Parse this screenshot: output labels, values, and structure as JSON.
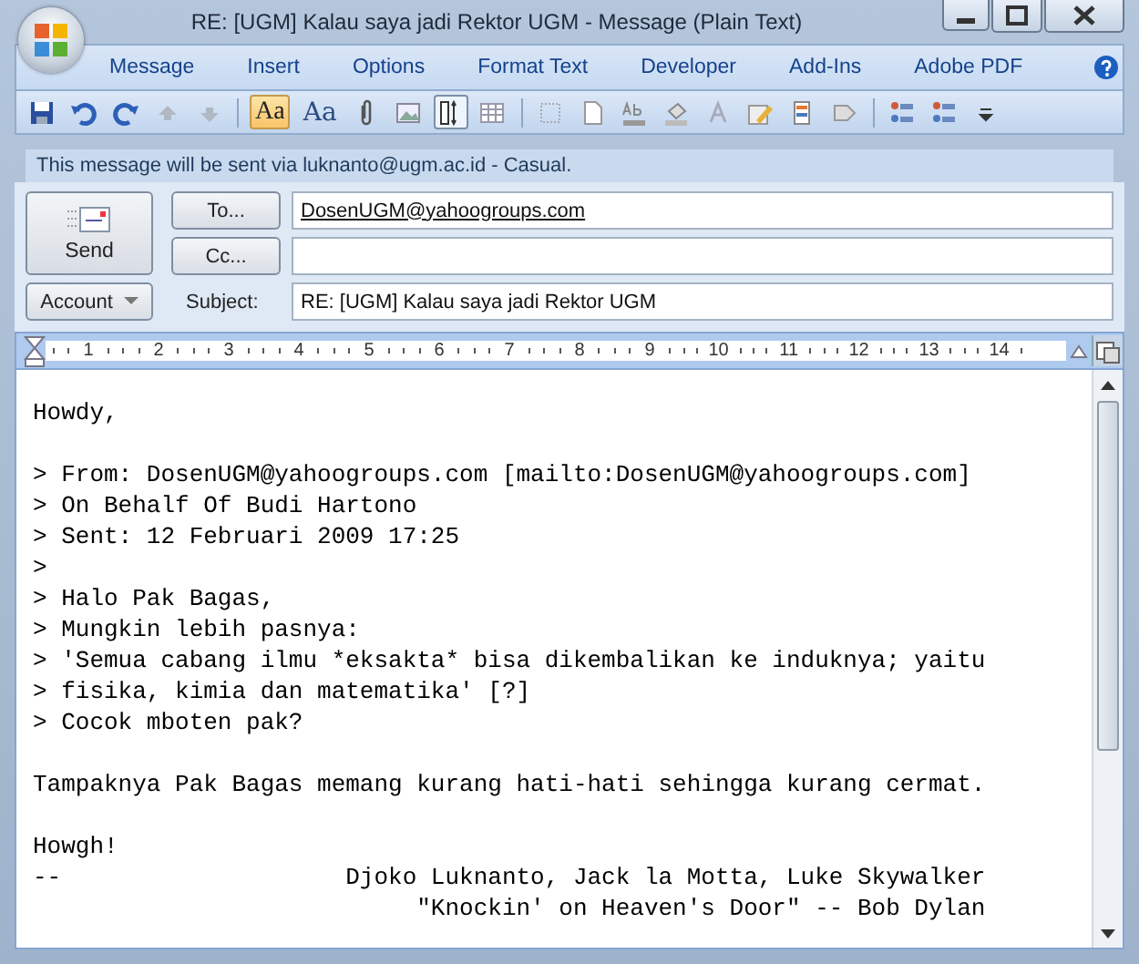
{
  "window": {
    "title": "RE: [UGM] Kalau saya jadi Rektor UGM - Message (Plain Text)"
  },
  "ribbon_tabs": [
    {
      "label": "Message"
    },
    {
      "label": "Insert"
    },
    {
      "label": "Options"
    },
    {
      "label": "Format Text"
    },
    {
      "label": "Developer"
    },
    {
      "label": "Add-Ins"
    },
    {
      "label": "Adobe PDF"
    }
  ],
  "toolbar": [
    {
      "kind": "save",
      "selected": false
    },
    {
      "kind": "undo",
      "selected": false
    },
    {
      "kind": "redo",
      "selected": false
    },
    {
      "kind": "up",
      "selected": false
    },
    {
      "kind": "down",
      "selected": false
    },
    {
      "kind": "sep"
    },
    {
      "kind": "text",
      "label": "Aa",
      "selected": true
    },
    {
      "kind": "text",
      "label": "Aa",
      "selected": false
    },
    {
      "kind": "clip",
      "selected": false
    },
    {
      "kind": "image",
      "selected": false
    },
    {
      "kind": "ruler",
      "selected": true
    },
    {
      "kind": "table",
      "selected": false
    },
    {
      "kind": "sep"
    },
    {
      "kind": "border",
      "selected": false
    },
    {
      "kind": "page",
      "selected": false
    },
    {
      "kind": "spell",
      "selected": false
    },
    {
      "kind": "fill",
      "selected": false
    },
    {
      "kind": "font",
      "selected": false
    },
    {
      "kind": "highlight",
      "selected": false
    },
    {
      "kind": "form",
      "selected": false
    },
    {
      "kind": "stamp",
      "selected": false
    },
    {
      "kind": "sep"
    },
    {
      "kind": "list",
      "selected": false
    },
    {
      "kind": "list",
      "selected": false
    },
    {
      "kind": "more",
      "selected": false
    }
  ],
  "info_bar": "This message will be sent via luknanto@ugm.ac.id - Casual.",
  "send_button": "Send",
  "to": {
    "button": "To...",
    "value": "DosenUGM@yahoogroups.com"
  },
  "cc": {
    "button": "Cc..."
  },
  "account_button": "Account",
  "subject": {
    "label": "Subject:",
    "value": "RE: [UGM] Kalau saya jadi Rektor UGM"
  },
  "ruler": [
    "1",
    "2",
    "3",
    "4",
    "5",
    "6",
    "7",
    "8",
    "9",
    "10",
    "11",
    "12",
    "13",
    "14"
  ],
  "body_paragraphs": [
    [
      "Howdy,"
    ],
    [
      "> From: DosenUGM@yahoogroups.com [mailto:DosenUGM@yahoogroups.com]",
      "> On Behalf Of Budi Hartono",
      "> Sent: 12 Februari 2009 17:25",
      ">",
      "> Halo Pak Bagas,",
      "> Mungkin lebih pasnya:",
      "> 'Semua cabang ilmu *eksakta* bisa dikembalikan ke induknya; yaitu",
      "> fisika, kimia dan matematika' [?]",
      "> Cocok mboten pak?"
    ],
    [
      "Tampaknya Pak Bagas memang kurang hati-hati sehingga kurang cermat."
    ],
    [
      "Howgh!",
      "--                    Djoko Luknanto, Jack la Motta, Luke Skywalker",
      "                           \"Knockin' on Heaven's Door\" -- Bob Dylan"
    ]
  ]
}
